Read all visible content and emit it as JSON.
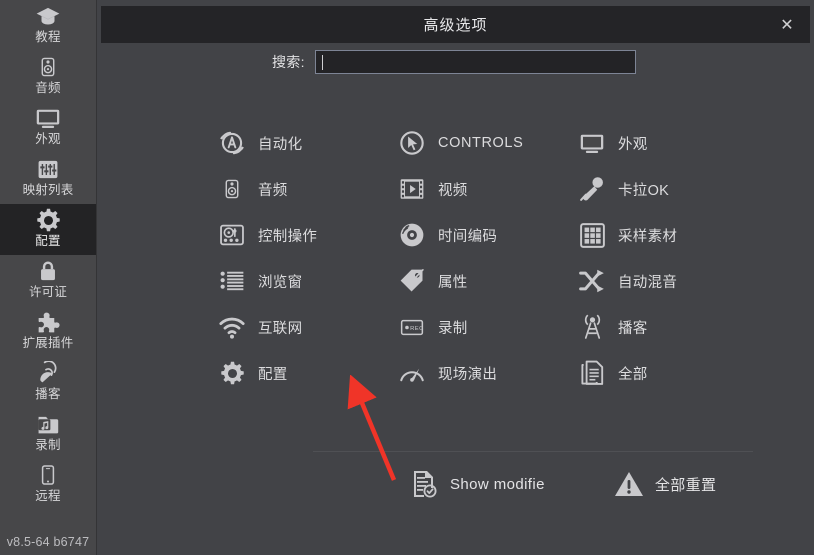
{
  "app": {
    "version": "v8.5-64 b6747"
  },
  "sidebar": {
    "items": [
      {
        "label": "教程",
        "icon": "graduation-cap-icon",
        "active": false
      },
      {
        "label": "音频",
        "icon": "speaker-icon",
        "active": false
      },
      {
        "label": "外观",
        "icon": "monitor-icon",
        "active": false
      },
      {
        "label": "映射列表",
        "icon": "sliders-icon",
        "active": false
      },
      {
        "label": "配置",
        "icon": "gear-icon",
        "active": true
      },
      {
        "label": "许可证",
        "icon": "lock-icon",
        "active": false
      },
      {
        "label": "扩展插件",
        "icon": "puzzle-piece-icon",
        "active": false
      },
      {
        "label": "播客",
        "icon": "podcast-icon",
        "active": false
      },
      {
        "label": "录制",
        "icon": "folder-music-icon",
        "active": false
      },
      {
        "label": "远程",
        "icon": "phone-icon",
        "active": false
      }
    ]
  },
  "dialog": {
    "title": "高级选项",
    "close_icon": "close-icon",
    "close_glyph": "✕",
    "search": {
      "label": "搜索:",
      "value": "",
      "placeholder": ""
    },
    "grid": [
      {
        "label": "自动化",
        "icon": "automation-icon"
      },
      {
        "label": "CONTROLS",
        "icon": "cursor-circle-icon"
      },
      {
        "label": "外观",
        "icon": "monitor-icon"
      },
      {
        "label": "音频",
        "icon": "speaker-icon"
      },
      {
        "label": "视频",
        "icon": "film-play-icon"
      },
      {
        "label": "卡拉OK",
        "icon": "microphone-icon"
      },
      {
        "label": "控制操作",
        "icon": "mixer-deck-icon"
      },
      {
        "label": "时间编码",
        "icon": "vinyl-record-icon"
      },
      {
        "label": "采样素材",
        "icon": "grid-pads-icon"
      },
      {
        "label": "浏览窗",
        "icon": "list-icon"
      },
      {
        "label": "属性",
        "icon": "tag-icon"
      },
      {
        "label": "自动混音",
        "icon": "shuffle-icon"
      },
      {
        "label": "互联网",
        "icon": "wifi-icon"
      },
      {
        "label": "录制",
        "icon": "rec-box-icon"
      },
      {
        "label": "播客",
        "icon": "broadcast-tower-icon"
      },
      {
        "label": "配置",
        "icon": "gear-icon"
      },
      {
        "label": "现场演出",
        "icon": "gauge-icon"
      },
      {
        "label": "全部",
        "icon": "documents-icon"
      }
    ],
    "footer": {
      "show_modified": {
        "label": "Show modifie",
        "icon": "document-check-icon"
      },
      "reset_all": {
        "label": "全部重置",
        "icon": "warning-triangle-icon"
      }
    }
  },
  "annotation": {
    "arrow_color": "#f03428",
    "points_to": "配置"
  },
  "colors": {
    "sidebar_bg": "#474749",
    "panel_bg": "#424347",
    "titlebar_bg": "#242427",
    "active_item_bg": "#232325",
    "icon_fill": "#c9c9cc",
    "text": "#dcdcde",
    "accent_red": "#f03428"
  }
}
